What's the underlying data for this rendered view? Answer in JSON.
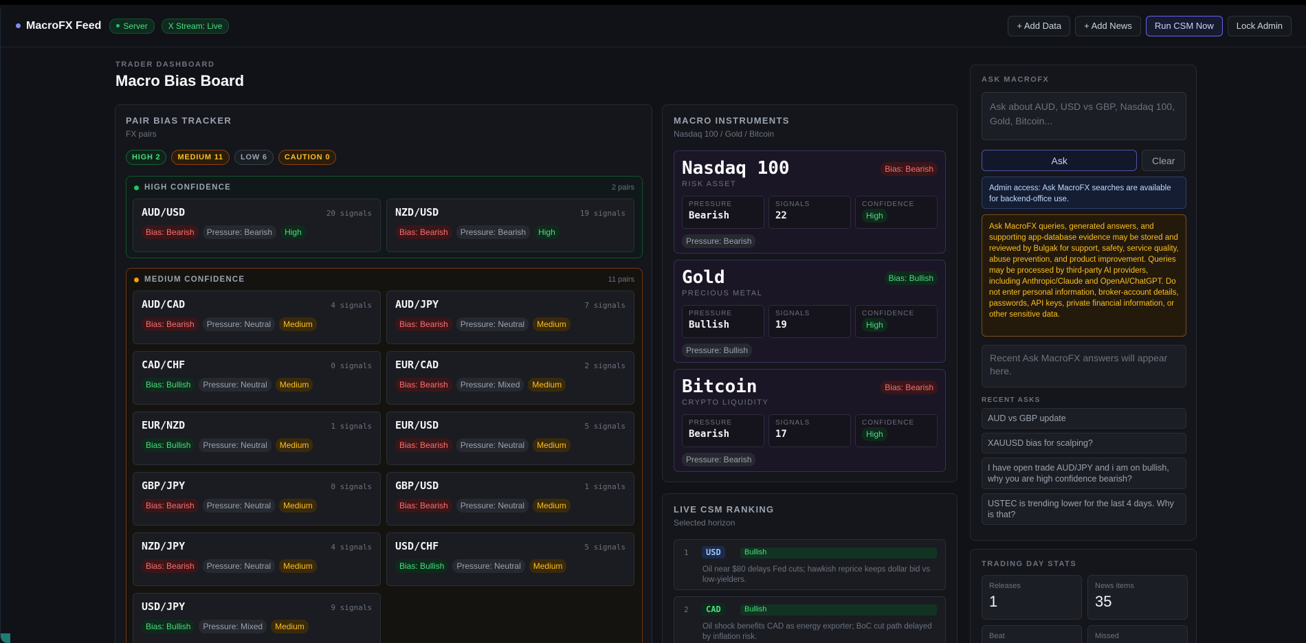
{
  "header": {
    "brand": "MacroFX Feed",
    "server_label": "Server",
    "stream_label": "X Stream: Live",
    "add_data": "+ Add Data",
    "add_news": "+ Add News",
    "run_csm": "Run CSM Now",
    "lock_admin": "Lock Admin"
  },
  "page": {
    "eyebrow": "TRADER DASHBOARD",
    "title": "Macro Bias Board"
  },
  "tracker": {
    "title": "PAIR BIAS TRACKER",
    "subtitle": "FX pairs",
    "counts": [
      "HIGH 2",
      "MEDIUM 11",
      "LOW 6",
      "CAUTION 0"
    ],
    "high_group": {
      "label": "HIGH CONFIDENCE",
      "count": "2 pairs",
      "color": "#22c55e",
      "pairs": [
        {
          "name": "AUD/USD",
          "signals": "20 signals",
          "bias": "Bias: Bearish",
          "pressure": "Pressure: Bearish",
          "conf": "High"
        },
        {
          "name": "NZD/USD",
          "signals": "19 signals",
          "bias": "Bias: Bearish",
          "pressure": "Pressure: Bearish",
          "conf": "High"
        }
      ]
    },
    "medium_group": {
      "label": "MEDIUM CONFIDENCE",
      "count": "11 pairs",
      "color": "#f59e0b",
      "pairs": [
        {
          "name": "AUD/CAD",
          "signals": "4 signals",
          "bias": "Bias: Bearish",
          "pressure": "Pressure: Neutral",
          "conf": "Medium"
        },
        {
          "name": "AUD/JPY",
          "signals": "7 signals",
          "bias": "Bias: Bearish",
          "pressure": "Pressure: Neutral",
          "conf": "Medium"
        },
        {
          "name": "CAD/CHF",
          "signals": "0 signals",
          "bias": "Bias: Bullish",
          "pressure": "Pressure: Neutral",
          "conf": "Medium"
        },
        {
          "name": "EUR/CAD",
          "signals": "2 signals",
          "bias": "Bias: Bearish",
          "pressure": "Pressure: Mixed",
          "conf": "Medium"
        },
        {
          "name": "EUR/NZD",
          "signals": "1 signals",
          "bias": "Bias: Bullish",
          "pressure": "Pressure: Neutral",
          "conf": "Medium"
        },
        {
          "name": "EUR/USD",
          "signals": "5 signals",
          "bias": "Bias: Bearish",
          "pressure": "Pressure: Neutral",
          "conf": "Medium"
        },
        {
          "name": "GBP/JPY",
          "signals": "0 signals",
          "bias": "Bias: Bearish",
          "pressure": "Pressure: Neutral",
          "conf": "Medium"
        },
        {
          "name": "GBP/USD",
          "signals": "1 signals",
          "bias": "Bias: Bearish",
          "pressure": "Pressure: Neutral",
          "conf": "Medium"
        },
        {
          "name": "NZD/JPY",
          "signals": "4 signals",
          "bias": "Bias: Bearish",
          "pressure": "Pressure: Neutral",
          "conf": "Medium"
        },
        {
          "name": "USD/CHF",
          "signals": "5 signals",
          "bias": "Bias: Bullish",
          "pressure": "Pressure: Neutral",
          "conf": "Medium"
        },
        {
          "name": "USD/JPY",
          "signals": "9 signals",
          "bias": "Bias: Bullish",
          "pressure": "Pressure: Mixed",
          "conf": "Medium"
        }
      ]
    }
  },
  "instruments": {
    "title": "MACRO INSTRUMENTS",
    "subtitle": "Nasdaq 100 / Gold / Bitcoin",
    "labels": {
      "pressure": "PRESSURE",
      "signals": "SIGNALS",
      "confidence": "CONFIDENCE"
    },
    "items": [
      {
        "name": "Nasdaq 100",
        "category": "RISK ASSET",
        "bias": "Bias: Bearish",
        "pressure": "Bearish",
        "signals": "22",
        "confidence": "High",
        "pressure_tag": "Pressure: Bearish"
      },
      {
        "name": "Gold",
        "category": "PRECIOUS METAL",
        "bias": "Bias: Bullish",
        "pressure": "Bullish",
        "signals": "19",
        "confidence": "High",
        "pressure_tag": "Pressure: Bullish"
      },
      {
        "name": "Bitcoin",
        "category": "CRYPTO LIQUIDITY",
        "bias": "Bias: Bearish",
        "pressure": "Bearish",
        "signals": "17",
        "confidence": "High",
        "pressure_tag": "Pressure: Bearish"
      }
    ]
  },
  "csm": {
    "title": "LIVE CSM RANKING",
    "subtitle": "Selected horizon",
    "rows": [
      {
        "rank": "1",
        "currency": "USD",
        "bias": "Bullish",
        "note": "Oil near $80 delays Fed cuts; hawkish reprice keeps dollar bid vs low-yielders."
      },
      {
        "rank": "2",
        "currency": "CAD",
        "bias": "Bullish",
        "note": "Oil shock benefits CAD as energy exporter; BoC cut path delayed by inflation risk."
      }
    ]
  },
  "ask": {
    "title": "ASK MACROFX",
    "placeholder": "Ask about AUD, USD vs GBP, Nasdaq 100, Gold, Bitcoin...",
    "ask_label": "Ask",
    "clear_label": "Clear",
    "admin_note": "Admin access: Ask MacroFX searches are available for backend-office use.",
    "disclaimer": "Ask MacroFX queries, generated answers, and supporting app-database evidence may be stored and reviewed by Bulgak for support, safety, service quality, abuse prevention, and product improvement. Queries may be processed by third-party AI providers, including Anthropic/Claude and OpenAI/ChatGPT. Do not enter personal information, broker-account details, passwords, API keys, private financial information, or other sensitive data.",
    "empty": "Recent Ask MacroFX answers will appear here.",
    "recent_label": "RECENT ASKS",
    "recent": [
      "AUD vs GBP update",
      "XAUUSD bias for scalping?",
      "I have open trade AUD/JPY and i am on bullish, why you are high confidence bearish?",
      "USTEC is trending lower for the last 4 days. Why is that?"
    ]
  },
  "stats": {
    "title": "TRADING DAY STATS",
    "cells": [
      {
        "label": "Releases",
        "value": "1"
      },
      {
        "label": "News items",
        "value": "35"
      },
      {
        "label": "Beat",
        "value": ""
      },
      {
        "label": "Missed",
        "value": ""
      }
    ]
  }
}
